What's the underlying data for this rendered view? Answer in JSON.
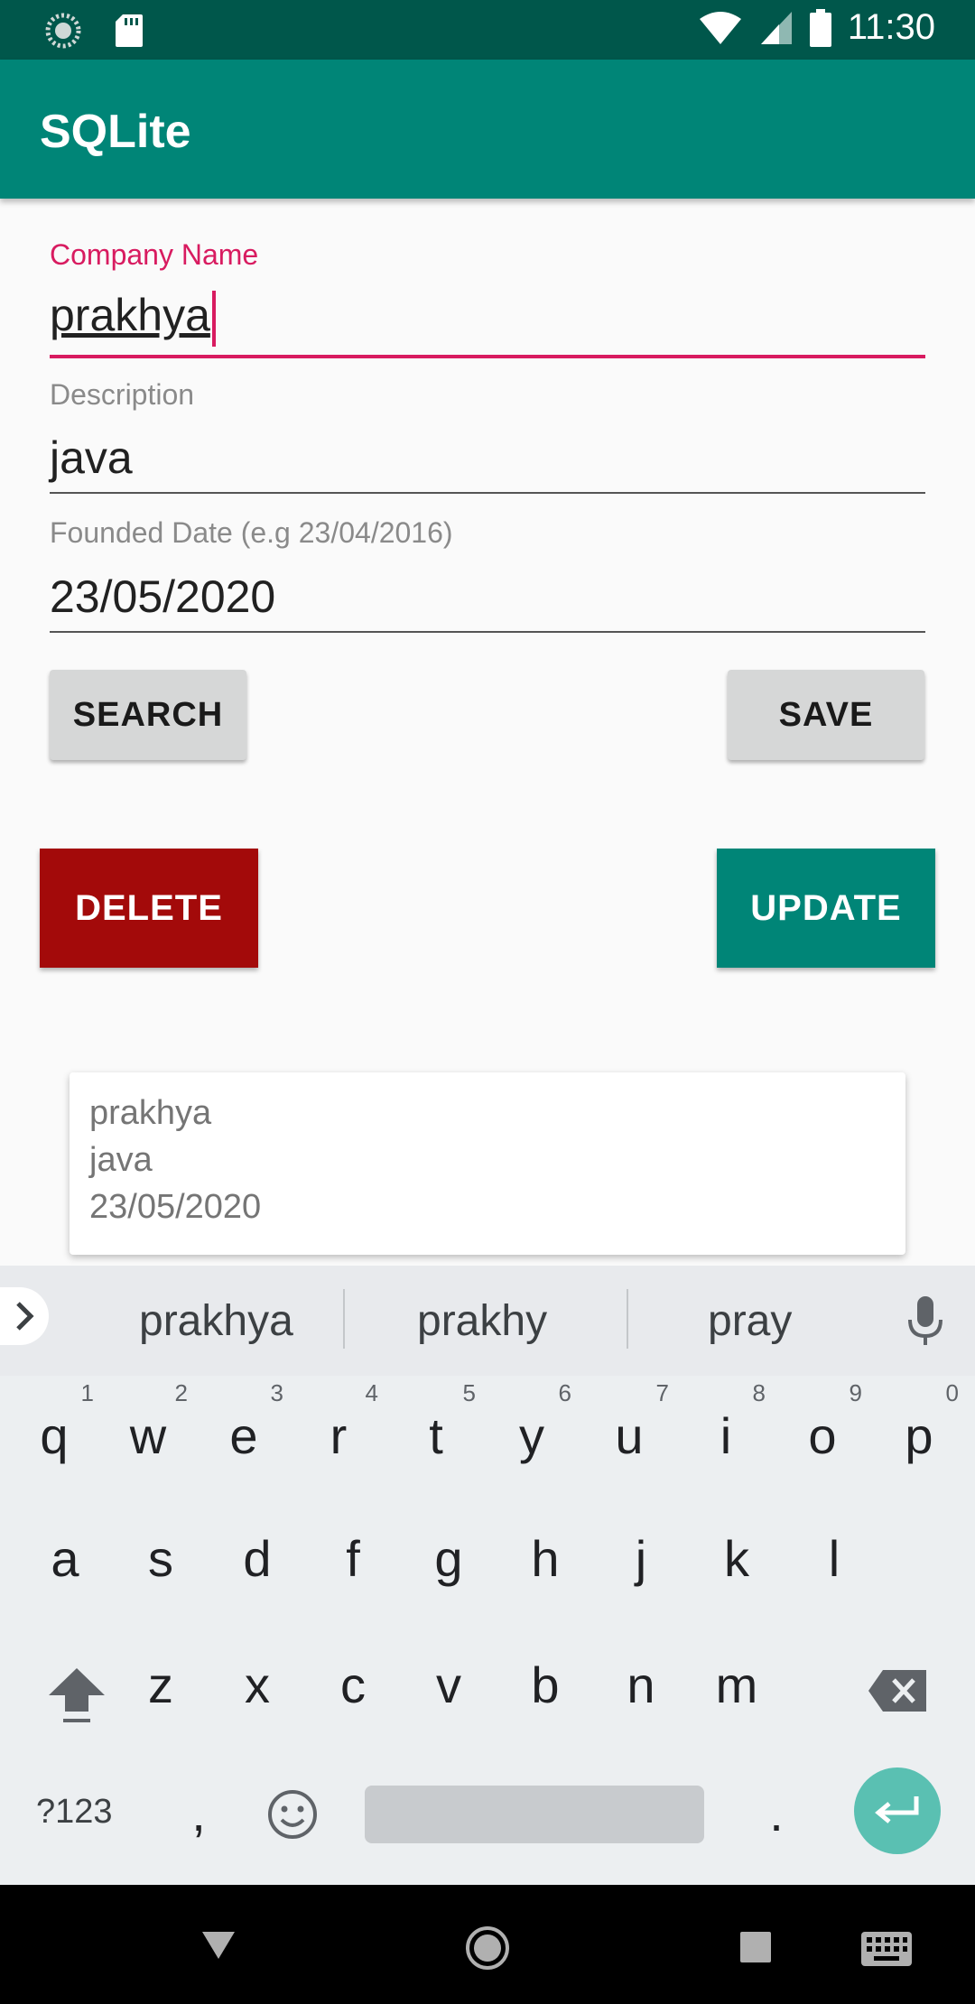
{
  "status_bar": {
    "time": "11:30"
  },
  "app_bar": {
    "title": "SQLite"
  },
  "form": {
    "company_name": {
      "label": "Company Name",
      "value": "prakhya"
    },
    "description": {
      "label": "Description",
      "value": "java"
    },
    "founded_date": {
      "label": "Founded Date (e.g 23/04/2016)",
      "value": "23/05/2020"
    }
  },
  "buttons": {
    "search": "SEARCH",
    "save": "SAVE",
    "delete": "DELETE",
    "update": "UPDATE",
    "delete_color": "#a30a0a",
    "update_color": "#008577"
  },
  "result_card": {
    "name": "prakhya",
    "description": "java",
    "date": "23/05/2020"
  },
  "keyboard": {
    "suggestions": [
      "prakhya",
      "prakhy",
      "pray"
    ],
    "row1": [
      {
        "k": "q",
        "n": "1"
      },
      {
        "k": "w",
        "n": "2"
      },
      {
        "k": "e",
        "n": "3"
      },
      {
        "k": "r",
        "n": "4"
      },
      {
        "k": "t",
        "n": "5"
      },
      {
        "k": "y",
        "n": "6"
      },
      {
        "k": "u",
        "n": "7"
      },
      {
        "k": "i",
        "n": "8"
      },
      {
        "k": "o",
        "n": "9"
      },
      {
        "k": "p",
        "n": "0"
      }
    ],
    "row2": [
      "a",
      "s",
      "d",
      "f",
      "g",
      "h",
      "j",
      "k",
      "l"
    ],
    "row3": [
      "z",
      "x",
      "c",
      "v",
      "b",
      "n",
      "m"
    ],
    "symbols_key": "?123",
    "comma_key": ",",
    "period_key": ".",
    "icons": [
      "expand-suggestions-icon",
      "mic-icon",
      "shift-icon",
      "backspace-icon",
      "emoji-icon",
      "enter-icon"
    ]
  },
  "nav_bar": {
    "icons": [
      "back-icon",
      "home-icon",
      "recents-icon",
      "keyboard-switch-icon"
    ]
  },
  "colors": {
    "status_bar": "#00574b",
    "app_bar": "#008577",
    "accent": "#d81b60",
    "enter_key": "#5ac0b2"
  }
}
